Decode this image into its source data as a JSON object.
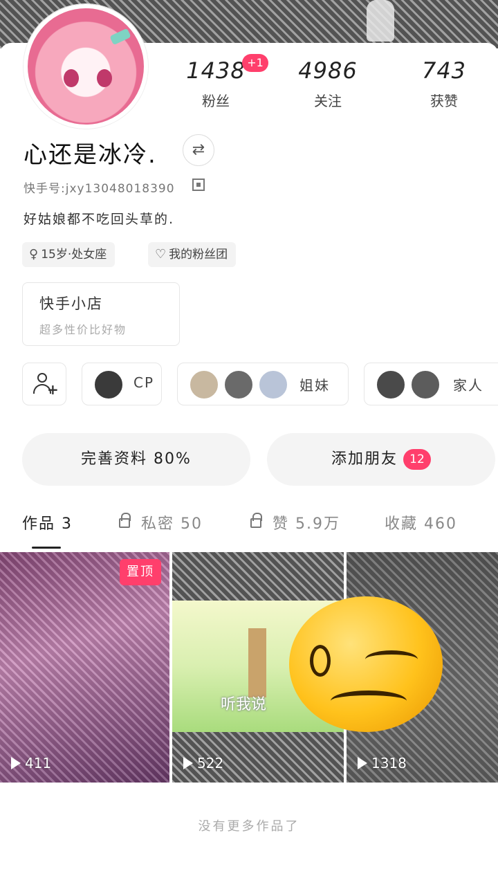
{
  "stats": {
    "fans": {
      "value": "1438",
      "label": "粉丝",
      "badge": "+1"
    },
    "following": {
      "value": "4986",
      "label": "关注"
    },
    "likes": {
      "value": "743",
      "label": "获赞"
    }
  },
  "profile": {
    "name": "心还是冰冷.",
    "switch_glyph": "⇄",
    "uid": "快手号:jxy13048018390",
    "bio": "好姑娘都不吃回头草的."
  },
  "tags": [
    {
      "icon": "♀",
      "text": "15岁·处女座"
    },
    {
      "icon": "♡",
      "text": "我的粉丝团"
    }
  ],
  "shop": {
    "title": "快手小店",
    "subtitle": "超多性价比好物"
  },
  "relations": {
    "cp": "CP",
    "sisters": "姐妹",
    "family": "家人"
  },
  "actions": {
    "complete_profile": "完善资料 80%",
    "add_friends": "添加朋友",
    "add_friends_badge": "12"
  },
  "tabs": [
    {
      "label": "作品 3",
      "locked": false
    },
    {
      "label": "私密 50",
      "locked": true
    },
    {
      "label": "赞 5.9万",
      "locked": true
    },
    {
      "label": "收藏 460",
      "locked": false
    }
  ],
  "videos": [
    {
      "plays": "411",
      "pinned_label": "置顶"
    },
    {
      "plays": "522",
      "caption": "听我说"
    },
    {
      "plays": "1318"
    }
  ],
  "footer": "没有更多作品了",
  "colors": {
    "accent": "#ff3f6c",
    "pill_bg": "#f4f4f4"
  }
}
